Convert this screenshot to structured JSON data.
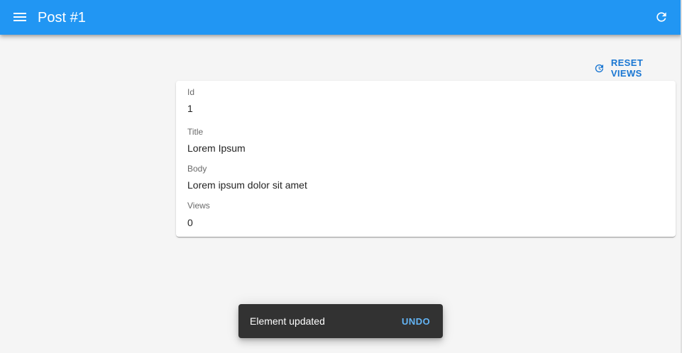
{
  "appbar": {
    "title": "Post #1",
    "menu_icon": "menu-icon",
    "refresh_icon": "refresh-icon",
    "color": "#2196f3"
  },
  "toolbar": {
    "reset_label": "RESET VIEWS",
    "reset_icon": "reset-icon"
  },
  "record": {
    "fields": [
      {
        "label": "Id",
        "value": "1"
      },
      {
        "label": "Title",
        "value": "Lorem Ipsum"
      },
      {
        "label": "Body",
        "value": "Lorem ipsum dolor sit amet"
      },
      {
        "label": "Views",
        "value": "0"
      }
    ]
  },
  "snackbar": {
    "message": "Element updated",
    "action_label": "UNDO"
  }
}
